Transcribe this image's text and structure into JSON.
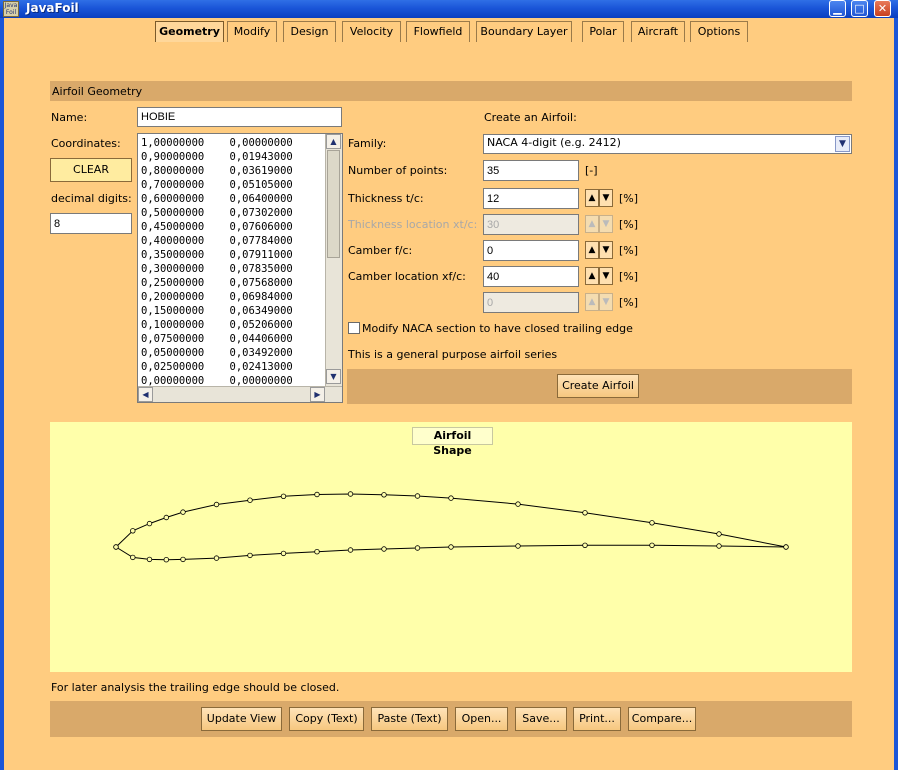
{
  "window": {
    "title": "JavaFoil",
    "icon_text": "Java Foil"
  },
  "tabs": [
    {
      "label": "Geometry",
      "selected": true
    },
    {
      "label": "Modify"
    },
    {
      "label": "Design"
    },
    {
      "label": "Velocity"
    },
    {
      "label": "Flowfield"
    },
    {
      "label": "Boundary Layer"
    },
    {
      "label": "Polar"
    },
    {
      "label": "Aircraft"
    },
    {
      "label": "Options"
    }
  ],
  "geometry": {
    "section_title": "Airfoil Geometry",
    "name_label": "Name:",
    "name_value": "HOBIE",
    "coordinates_label": "Coordinates:",
    "clear_label": "CLEAR",
    "decimal_digits_label": "decimal digits:",
    "decimal_digits_value": "8",
    "coordinates": [
      [
        "1,00000000",
        "0,00000000"
      ],
      [
        "0,90000000",
        "0,01943000"
      ],
      [
        "0,80000000",
        "0,03619000"
      ],
      [
        "0,70000000",
        "0,05105000"
      ],
      [
        "0,60000000",
        "0,06400000"
      ],
      [
        "0,50000000",
        "0,07302000"
      ],
      [
        "0,45000000",
        "0,07606000"
      ],
      [
        "0,40000000",
        "0,07784000"
      ],
      [
        "0,35000000",
        "0,07911000"
      ],
      [
        "0,30000000",
        "0,07835000"
      ],
      [
        "0,25000000",
        "0,07568000"
      ],
      [
        "0,20000000",
        "0,06984000"
      ],
      [
        "0,15000000",
        "0,06349000"
      ],
      [
        "0,10000000",
        "0,05206000"
      ],
      [
        "0,07500000",
        "0,04406000"
      ],
      [
        "0,05000000",
        "0,03492000"
      ],
      [
        "0,02500000",
        "0,02413000"
      ],
      [
        "0,00000000",
        "0,00000000"
      ]
    ]
  },
  "create": {
    "heading": "Create an Airfoil:",
    "family_label": "Family:",
    "family_value": "NACA 4-digit (e.g. 2412)",
    "points_label": "Number of points:",
    "points_value": "35",
    "points_unit": "[-]",
    "thickness_label": "Thickness  t/c:",
    "thickness_value": "12",
    "thickness_loc_label": "Thickness location  xt/c:",
    "thickness_loc_value": "30",
    "camber_label": "Camber  f/c:",
    "camber_value": "0",
    "camber_loc_label": "Camber location  xf/c:",
    "camber_loc_value": "40",
    "extra_value": "0",
    "percent_unit": "[%]",
    "closed_te_label": "Modify NACA section to have closed trailing edge",
    "description": "This is a general purpose airfoil series",
    "create_button": "Create Airfoil"
  },
  "shape": {
    "title": "Airfoil Shape",
    "note": "For later analysis the trailing edge should be closed."
  },
  "chart_data": {
    "type": "line",
    "title": "Airfoil Shape",
    "series": [
      {
        "points": [
          [
            1,
            0
          ],
          [
            0.9,
            0.01943
          ],
          [
            0.8,
            0.03619
          ],
          [
            0.7,
            0.05105
          ],
          [
            0.6,
            0.064
          ],
          [
            0.5,
            0.07302
          ],
          [
            0.45,
            0.07606
          ],
          [
            0.4,
            0.07784
          ],
          [
            0.35,
            0.07911
          ],
          [
            0.3,
            0.07835
          ],
          [
            0.25,
            0.07568
          ],
          [
            0.2,
            0.06984
          ],
          [
            0.15,
            0.06349
          ],
          [
            0.1,
            0.05206
          ],
          [
            0.075,
            0.04406
          ],
          [
            0.05,
            0.03492
          ],
          [
            0.025,
            0.02413
          ],
          [
            0,
            0
          ]
        ]
      },
      {
        "points": [
          [
            0,
            0
          ],
          [
            0.025,
            -0.0155
          ],
          [
            0.05,
            -0.0185
          ],
          [
            0.075,
            -0.019
          ],
          [
            0.1,
            -0.0185
          ],
          [
            0.15,
            -0.0165
          ],
          [
            0.2,
            -0.0125
          ],
          [
            0.25,
            -0.0095
          ],
          [
            0.3,
            -0.007
          ],
          [
            0.35,
            -0.0045
          ],
          [
            0.4,
            -0.003
          ],
          [
            0.45,
            -0.0015
          ],
          [
            0.5,
            0.0
          ],
          [
            0.6,
            0.0015
          ],
          [
            0.7,
            0.0025
          ],
          [
            0.8,
            0.0025
          ],
          [
            0.9,
            0.0015
          ],
          [
            1,
            0
          ]
        ]
      }
    ],
    "grid": false,
    "markers": "circle"
  },
  "bottom_buttons": [
    "Update View",
    "Copy (Text)",
    "Paste (Text)",
    "Open...",
    "Save...",
    "Print...",
    "Compare..."
  ]
}
